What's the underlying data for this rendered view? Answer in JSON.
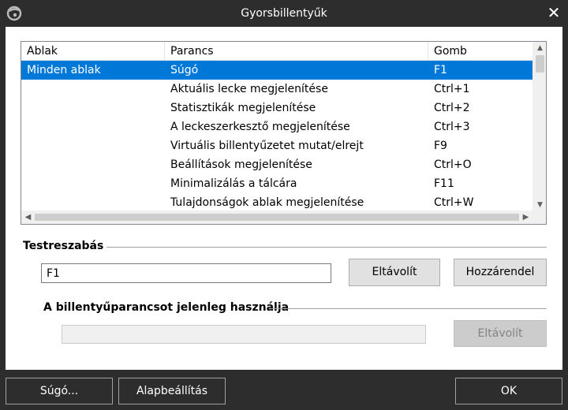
{
  "window": {
    "title": "Gyorsbillentyűk",
    "close_glyph": "✕"
  },
  "listview": {
    "columns": [
      "Ablak",
      "Parancs",
      "Gomb"
    ],
    "rows": [
      {
        "window": "Minden ablak",
        "command": "Súgó",
        "key": "F1",
        "selected": true
      },
      {
        "window": "",
        "command": "Aktuális lecke megjelenítése",
        "key": "Ctrl+1"
      },
      {
        "window": "",
        "command": "Statisztikák megjelenítése",
        "key": "Ctrl+2"
      },
      {
        "window": "",
        "command": "A leckeszerkesztő megjelenítése",
        "key": "Ctrl+3"
      },
      {
        "window": "",
        "command": "Virtuális billentyűzetet mutat/elrejt",
        "key": "F9"
      },
      {
        "window": "",
        "command": "Beállítások megjelenítése",
        "key": "Ctrl+O"
      },
      {
        "window": "",
        "command": "Minimalizálás a tálcára",
        "key": "F11"
      },
      {
        "window": "",
        "command": "Tulajdonságok ablak megjelenítése",
        "key": "Ctrl+W"
      }
    ]
  },
  "customize": {
    "section_label": "Testreszabás",
    "shortcut_value": "F1",
    "remove_label": "Eltávolít",
    "assign_label": "Hozzárendel"
  },
  "in_use": {
    "section_label": "A billentyűparancsot jelenleg használja",
    "current_value": "",
    "remove_label": "Eltávolít"
  },
  "footer": {
    "help_label": "Súgó...",
    "defaults_label": "Alapbeállítás",
    "ok_label": "OK"
  },
  "colors": {
    "title_bar": "#2d2d2d",
    "selection": "#0078d7",
    "content_bg": "#ffffff"
  }
}
